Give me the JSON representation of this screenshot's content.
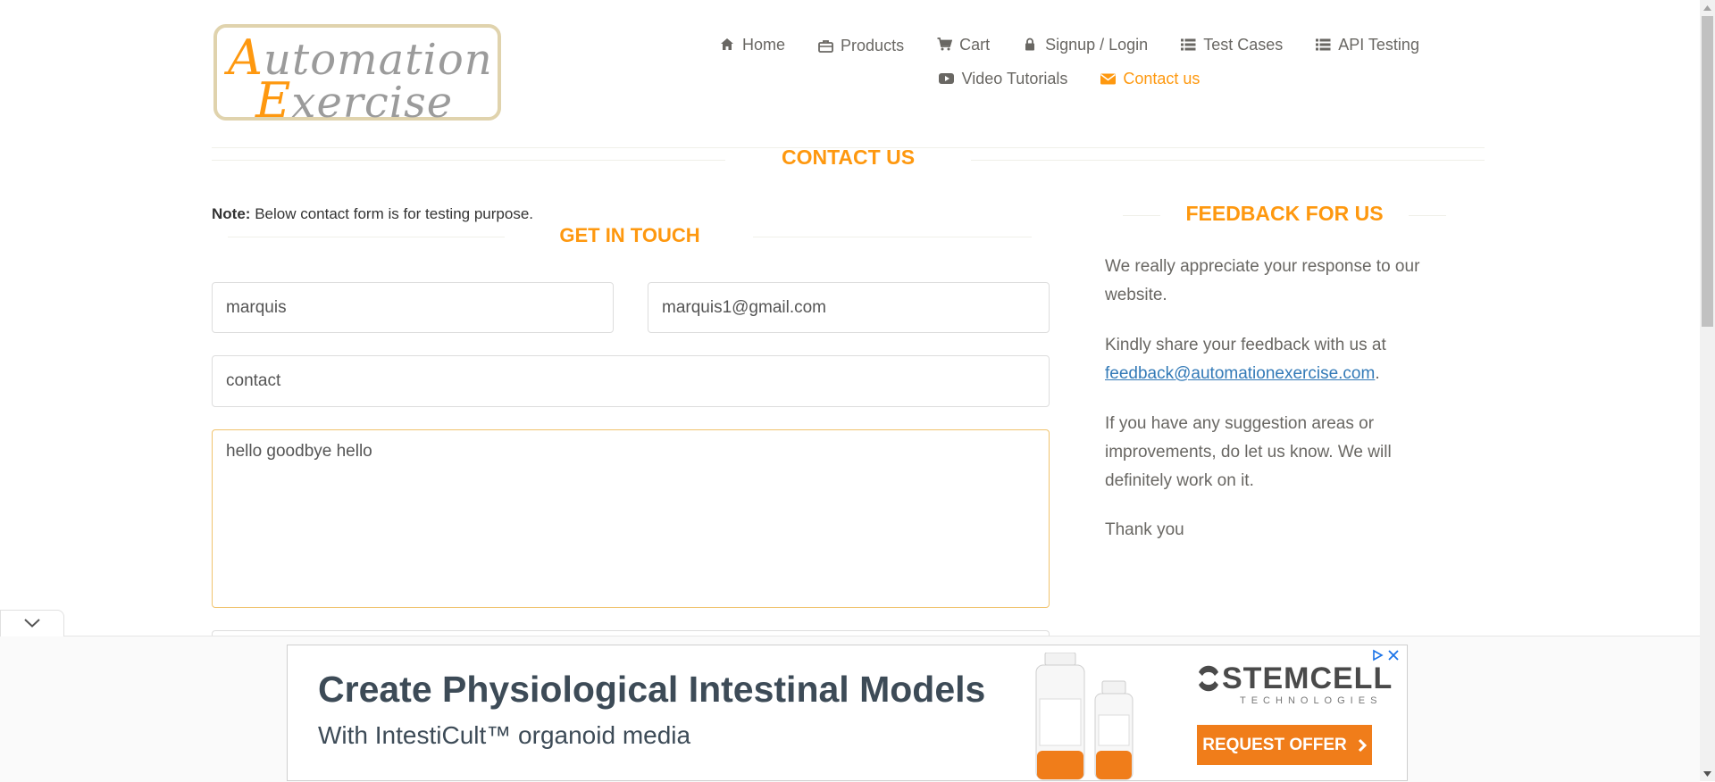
{
  "logo": {
    "line1_cap": "A",
    "line1_rest": "utomation",
    "line2_cap": "E",
    "line2_rest": "xercise"
  },
  "nav": {
    "row1": [
      {
        "label": "Home",
        "icon": "home-icon"
      },
      {
        "label": "Products",
        "icon": "briefcase-icon"
      },
      {
        "label": "Cart",
        "icon": "cart-icon"
      },
      {
        "label": "Signup / Login",
        "icon": "lock-icon"
      },
      {
        "label": "Test Cases",
        "icon": "list-icon"
      },
      {
        "label": "API Testing",
        "icon": "list-icon"
      }
    ],
    "row2": [
      {
        "label": "Video Tutorials",
        "icon": "youtube-icon"
      },
      {
        "label": "Contact us",
        "icon": "envelope-icon",
        "active": true
      }
    ]
  },
  "contact": {
    "title": "Contact us",
    "note_bold": "Note:",
    "note_text": "Below contact form is for testing purpose.",
    "get_in_touch": "Get In Touch",
    "name_value": "marquis",
    "email_value": "marquis1@gmail.com",
    "subject_value": "contact",
    "message_value": "hello goodbye hello"
  },
  "feedback": {
    "title": "Feedback For Us",
    "p1": "We really appreciate your response to our website.",
    "p2_text": "Kindly share your feedback with us at",
    "p2_link": "feedback@automationexercise.com",
    "p2_after": ".",
    "p3": "If you have any suggestion areas or improvements, do let us know. We will definitely work on it.",
    "p4": "Thank you"
  },
  "ad": {
    "headline": "Create Physiological Intestinal Models",
    "subline": "With IntestiCult™ organoid media",
    "brand": "STEMCELL",
    "brand_sub": "TECHNOLOGIES",
    "cta": "REQUEST OFFER"
  },
  "colors": {
    "accent": "#fe980f",
    "text": "#696763",
    "link": "#337ab7",
    "ad_cta": "#f07d1a"
  }
}
